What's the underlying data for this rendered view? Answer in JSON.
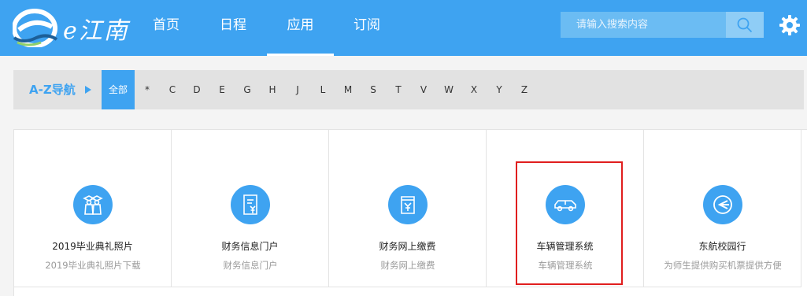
{
  "header": {
    "logo_text": "e江南",
    "nav": [
      {
        "label": "首页",
        "active": false
      },
      {
        "label": "日程",
        "active": false
      },
      {
        "label": "应用",
        "active": true
      },
      {
        "label": "订阅",
        "active": false
      }
    ],
    "search": {
      "placeholder": "请输入搜索内容"
    },
    "settings_icon": "gear-icon",
    "accent_color": "#3ea3f1"
  },
  "az_nav": {
    "title": "A-Z导航",
    "all_label": "全部",
    "letters": [
      "*",
      "C",
      "D",
      "E",
      "G",
      "H",
      "J",
      "L",
      "M",
      "S",
      "T",
      "V",
      "W",
      "X",
      "Y",
      "Z"
    ]
  },
  "apps": [
    {
      "title": "2019毕业典礼照片",
      "desc": "2019毕业典礼照片下载",
      "icon": "graduates-icon"
    },
    {
      "title": "财务信息门户",
      "desc": "财务信息门户",
      "icon": "finance-document-icon"
    },
    {
      "title": "财务网上缴费",
      "desc": "财务网上缴费",
      "icon": "payment-icon"
    },
    {
      "title": "车辆管理系统",
      "desc": "车辆管理系统",
      "icon": "car-icon"
    },
    {
      "title": "东航校园行",
      "desc": "为师生提供购买机票提供方便",
      "icon": "airline-icon"
    }
  ]
}
